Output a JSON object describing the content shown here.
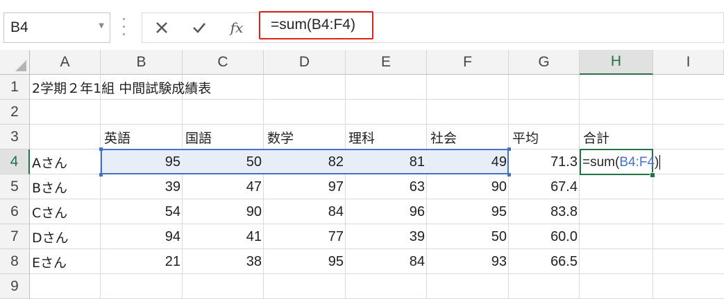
{
  "name_box": {
    "value": "B4"
  },
  "formula_bar": {
    "cancel_icon": "close-icon",
    "enter_icon": "checkmark-icon",
    "fx_label": "fx",
    "formula": "=sum(B4:F4)"
  },
  "columns": [
    "A",
    "B",
    "C",
    "D",
    "E",
    "F",
    "G",
    "H",
    "I"
  ],
  "rows": [
    "1",
    "2",
    "3",
    "4",
    "5",
    "6",
    "7",
    "8",
    "9"
  ],
  "sheet": {
    "title": "2学期２年1組 中間試験成績表",
    "headers": [
      "英語",
      "国語",
      "数学",
      "理科",
      "社会",
      "平均",
      "合計"
    ],
    "students": [
      {
        "name": "Aさん",
        "scores": [
          "95",
          "50",
          "82",
          "81",
          "49"
        ],
        "avg": "71.3"
      },
      {
        "name": "Bさん",
        "scores": [
          "39",
          "47",
          "97",
          "63",
          "90"
        ],
        "avg": "67.4"
      },
      {
        "name": "Cさん",
        "scores": [
          "54",
          "90",
          "84",
          "96",
          "95"
        ],
        "avg": "83.8"
      },
      {
        "name": "Dさん",
        "scores": [
          "94",
          "41",
          "77",
          "39",
          "50"
        ],
        "avg": "60.0"
      },
      {
        "name": "Eさん",
        "scores": [
          "21",
          "38",
          "95",
          "84",
          "93"
        ],
        "avg": "66.5"
      }
    ]
  },
  "edit_cell": {
    "prefix": "=sum(",
    "reference": "B4:F4",
    "suffix": ")"
  },
  "colors": {
    "selection_blue": "#4472c4",
    "active_green": "#217346",
    "highlight_red": "#e0201b"
  }
}
